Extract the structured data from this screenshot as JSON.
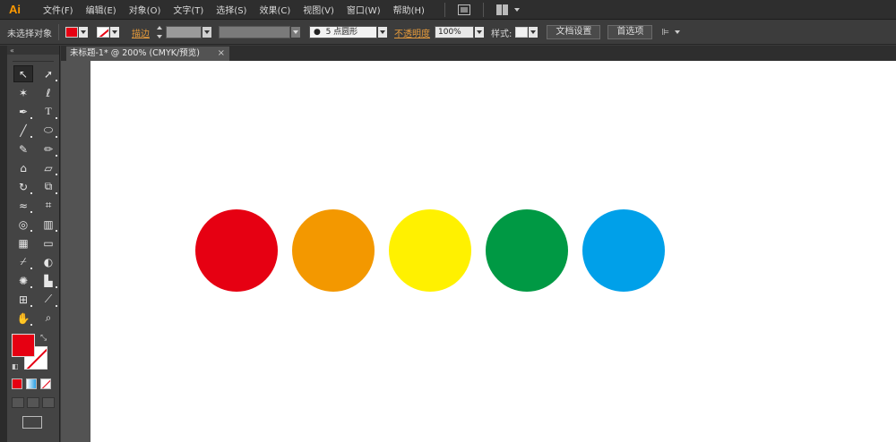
{
  "app": {
    "logo": "Ai"
  },
  "menu": {
    "items": [
      "文件(F)",
      "编辑(E)",
      "对象(O)",
      "文字(T)",
      "选择(S)",
      "效果(C)",
      "视图(V)",
      "窗口(W)",
      "帮助(H)"
    ]
  },
  "control": {
    "selection": "未选择对象",
    "stroke_label": "描边",
    "brush": "5 点圆形",
    "opacity_label": "不透明度",
    "opacity_value": "100%",
    "style_label": "样式:",
    "doc_setup": "文档设置",
    "preferences": "首选项"
  },
  "document": {
    "tab_title": "未标题-1* @ 200% (CMYK/预览)",
    "close_glyph": "×"
  },
  "toolbox": {
    "collapse_glyph": "«"
  },
  "colors": {
    "fill": "#e60012",
    "circles": [
      "#e60012",
      "#f39800",
      "#fff100",
      "#009944",
      "#00a0e9"
    ]
  },
  "icons": {
    "tools": [
      "selection-icon",
      "direct-selection-icon",
      "magic-wand-icon",
      "lasso-icon",
      "pen-icon",
      "type-icon",
      "line-segment-icon",
      "ellipse-icon",
      "paintbrush-icon",
      "pencil-icon",
      "blob-brush-icon",
      "eraser-icon",
      "rotate-icon",
      "scale-icon",
      "width-icon",
      "free-transform-icon",
      "shape-builder-icon",
      "perspective-grid-icon",
      "mesh-icon",
      "gradient-icon",
      "eyedropper-icon",
      "blend-icon",
      "symbol-sprayer-icon",
      "column-graph-icon",
      "artboard-icon",
      "slice-icon",
      "hand-icon",
      "zoom-icon"
    ]
  }
}
